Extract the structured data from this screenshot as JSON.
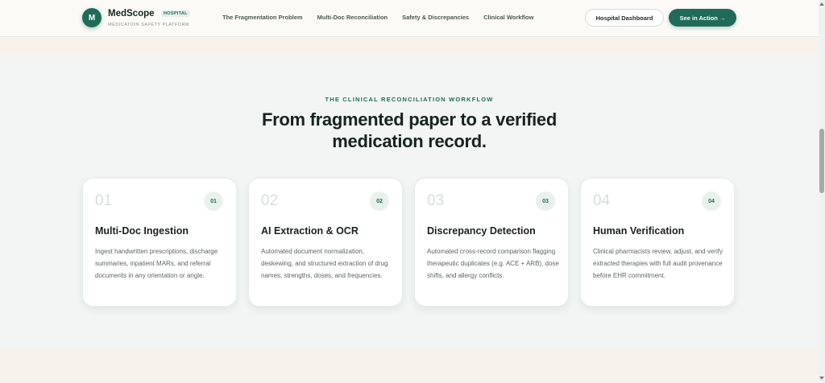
{
  "brand": {
    "mark": "M",
    "name": "MedScope",
    "badge": "HOSPITAL",
    "subtitle": "MEDICATION SAFETY PLATFORM"
  },
  "nav": {
    "links": [
      "The Fragmentation Problem",
      "Multi-Doc Reconciliation",
      "Safety & Discrepancies",
      "Clinical Workflow"
    ],
    "dashboard_label": "Hospital Dashboard",
    "cta_label": "See in Action →"
  },
  "section": {
    "eyebrow": "THE CLINICAL RECONCILIATION WORKFLOW",
    "headline_line1": "From fragmented paper to a verified",
    "headline_line2": "medication record."
  },
  "cards": [
    {
      "num": "01",
      "chip": "01",
      "title": "Multi-Doc Ingestion",
      "desc": "Ingest handwritten prescriptions, discharge summaries, inpatient MARs, and referral documents in any orientation or angle."
    },
    {
      "num": "02",
      "chip": "02",
      "title": "AI Extraction & OCR",
      "desc": "Automated document normalization, deskewing, and structured extraction of drug names, strengths, doses, and frequencies."
    },
    {
      "num": "03",
      "chip": "03",
      "title": "Discrepancy Detection",
      "desc": "Automated cross-record comparison flagging therapeutic duplicates (e.g. ACE + ARB), dose shifts, and allergy conflicts."
    },
    {
      "num": "04",
      "chip": "04",
      "title": "Human Verification",
      "desc": "Clinical pharmacists review, adjust, and verify extracted therapies with full audit provenance before EHR commitment."
    }
  ],
  "colors": {
    "brand_green": "#1f6b57",
    "page_bg": "#f2f5f3",
    "band_bg": "#f7f3ec"
  }
}
